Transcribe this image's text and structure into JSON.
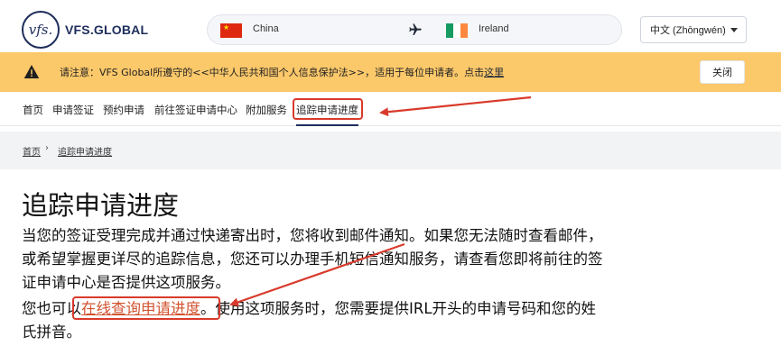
{
  "header": {
    "logo_mark": "vfs.",
    "logo_text": "VFS.GLOBAL",
    "route": {
      "from": "China",
      "to": "Ireland"
    },
    "language": "中文 (Zhōngwén)"
  },
  "notice": {
    "text": "请注意：VFS Global所遵守的<<中华人民共和国个人信息保护法>>，适用于每位申请者。点击",
    "link": "这里",
    "close_label": "关闭"
  },
  "nav": {
    "items": [
      "首页",
      "申请签证",
      "预约申请",
      "前往签证申请中心",
      "附加服务",
      "追踪申请进度"
    ]
  },
  "breadcrumb": {
    "home": "首页",
    "separator": "›",
    "current": "追踪申请进度"
  },
  "content": {
    "title": "追踪申请进度",
    "para1": "当您的签证受理完成并通过快递寄出时，您将收到邮件通知。如果您无法随时查看邮件，或希望掌握更详尽的追踪信息，您还可以办理手机短信通知服务，请查看您即将前往的签证申请中心是否提供这项服务。",
    "para2_pre": "您也可以",
    "para2_link": "在线查询申请进度",
    "para2_post": "。使用这项服务时，您需要提供IRL开头的申请号码和您的姓氏拼音。"
  },
  "colors": {
    "brand_navy": "#1e2e5c",
    "notice_bg": "#fbc86a",
    "link_orange": "#d2532f",
    "annotation_red": "#d93a2b"
  },
  "icons": [
    "flag-china-icon",
    "plane-icon",
    "flag-ireland-icon",
    "warning-icon",
    "chevron-down-icon"
  ]
}
